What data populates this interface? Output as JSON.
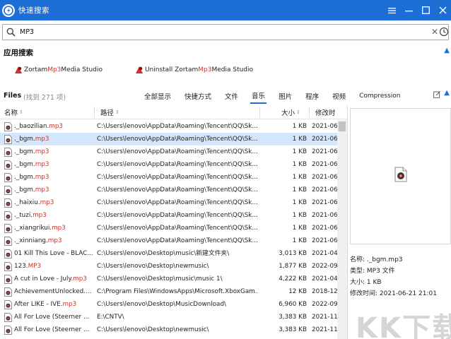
{
  "window": {
    "title": "快速搜索",
    "accent_color": "#1d6fd6",
    "controls": [
      "menu-icon",
      "minimize-icon",
      "maximize-icon",
      "close-icon"
    ]
  },
  "search": {
    "value": "MP3"
  },
  "app_section": {
    "title": "应用搜索",
    "items": [
      {
        "pre": "Zortam ",
        "hl": "Mp3",
        "post": " Media Studio",
        "icon": "zortam-app-icon"
      },
      {
        "pre": "Uninstall Zortam ",
        "hl": "Mp3",
        "post": " Media Studio",
        "icon": "zortam-app-icon"
      }
    ]
  },
  "files": {
    "label": "Files",
    "count_text": "(找到 271 项)",
    "tabs": [
      {
        "label": "全部显示",
        "active": false
      },
      {
        "label": "快捷方式",
        "active": false
      },
      {
        "label": "文件",
        "active": false
      },
      {
        "label": "音乐",
        "active": true
      },
      {
        "label": "图片",
        "active": false
      },
      {
        "label": "程序",
        "active": false
      },
      {
        "label": "视频",
        "active": false
      },
      {
        "label": "Compression",
        "active": false
      }
    ]
  },
  "table": {
    "columns": {
      "name": "名称",
      "path": "路径",
      "size": "大小",
      "date": "修改时"
    },
    "highlight_color": "#d2312d",
    "rows": [
      {
        "name_pre": "._baozilian.",
        "name_hl": "mp3",
        "path": "C:\\Users\\lenovo\\AppData\\Roaming\\Tencent\\QQ\\Sk...",
        "size": "1 KB",
        "date": "2021-06",
        "selected": false
      },
      {
        "name_pre": "._bgm.",
        "name_hl": "mp3",
        "path": "C:\\Users\\lenovo\\AppData\\Roaming\\Tencent\\QQ\\Sk...",
        "size": "1 KB",
        "date": "2021-06",
        "selected": true
      },
      {
        "name_pre": "._bgm.",
        "name_hl": "mp3",
        "path": "C:\\Users\\lenovo\\AppData\\Roaming\\Tencent\\QQ\\Sk...",
        "size": "1 KB",
        "date": "2021-06",
        "selected": false
      },
      {
        "name_pre": "._bgm.",
        "name_hl": "mp3",
        "path": "C:\\Users\\lenovo\\AppData\\Roaming\\Tencent\\QQ\\Sk...",
        "size": "1 KB",
        "date": "2021-06",
        "selected": false
      },
      {
        "name_pre": "._bgm.",
        "name_hl": "mp3",
        "path": "C:\\Users\\lenovo\\AppData\\Roaming\\Tencent\\QQ\\Sk...",
        "size": "1 KB",
        "date": "2021-06",
        "selected": false
      },
      {
        "name_pre": "._bgm.",
        "name_hl": "mp3",
        "path": "C:\\Users\\lenovo\\AppData\\Roaming\\Tencent\\QQ\\Sk...",
        "size": "1 KB",
        "date": "2021-06",
        "selected": false
      },
      {
        "name_pre": "._haixiu.",
        "name_hl": "mp3",
        "path": "C:\\Users\\lenovo\\AppData\\Roaming\\Tencent\\QQ\\Sk...",
        "size": "1 KB",
        "date": "2021-06",
        "selected": false
      },
      {
        "name_pre": "._tuzi.",
        "name_hl": "mp3",
        "path": "C:\\Users\\lenovo\\AppData\\Roaming\\Tencent\\QQ\\Sk...",
        "size": "1 KB",
        "date": "2021-06",
        "selected": false
      },
      {
        "name_pre": "._xiangrikui.",
        "name_hl": "mp3",
        "path": "C:\\Users\\lenovo\\AppData\\Roaming\\Tencent\\QQ\\Sk...",
        "size": "1 KB",
        "date": "2021-06",
        "selected": false
      },
      {
        "name_pre": "._xinniang.",
        "name_hl": "mp3",
        "path": "C:\\Users\\lenovo\\AppData\\Roaming\\Tencent\\QQ\\Sk...",
        "size": "1 KB",
        "date": "2021-06",
        "selected": false
      },
      {
        "name_pre": "01 Kill This Love - BLAC...",
        "name_hl": "",
        "path": "C:\\Users\\lenovo\\Desktop\\music\\新建文件夹\\",
        "size": "3,013 KB",
        "date": "2021-04",
        "selected": false
      },
      {
        "name_pre": "123.",
        "name_hl": "MP3",
        "path": "C:\\Users\\lenovo\\Desktop\\newmusic\\",
        "size": "1,877 KB",
        "date": "2022-09",
        "selected": false
      },
      {
        "name_pre": "A cut in Love - July.",
        "name_hl": "mp3",
        "path": "C:\\Users\\lenovo\\Desktop\\music\\music 1\\",
        "size": "4,222 KB",
        "date": "2021-04",
        "selected": false
      },
      {
        "name_pre": "AchievementUnlocked....",
        "name_hl": "",
        "path": "C:\\Program Files\\WindowsApps\\Microsoft.XboxGam...",
        "size": "12 KB",
        "date": "2018-12",
        "selected": false
      },
      {
        "name_pre": "After LIKE - IVE.",
        "name_hl": "mp3",
        "path": "C:\\Users\\lenovo\\Desktop\\MusicDownload\\",
        "size": "6,960 KB",
        "date": "2022-09",
        "selected": false
      },
      {
        "name_pre": "All For Love (Steerner ...",
        "name_hl": "",
        "path": "E:\\CNTV\\",
        "size": "3,383 KB",
        "date": "2021-11",
        "selected": false
      },
      {
        "name_pre": "All For Love (Steerner ...",
        "name_hl": "",
        "path": "C:\\Users\\lenovo\\Desktop\\newmusic\\",
        "size": "3,383 KB",
        "date": "2021-11",
        "selected": false
      },
      {
        "name_pre": "",
        "name_hl": "",
        "path": "",
        "size": "",
        "date": "",
        "selected": false
      }
    ]
  },
  "preview": {
    "name_line": "名称: ._bgm.mp3",
    "type_line": "类型: MP3 文件",
    "size_line": "大小: 1 KB",
    "time_line": "修改时间: 2021-06-21 21:01"
  },
  "watermark": {
    "text": "KK下载"
  }
}
